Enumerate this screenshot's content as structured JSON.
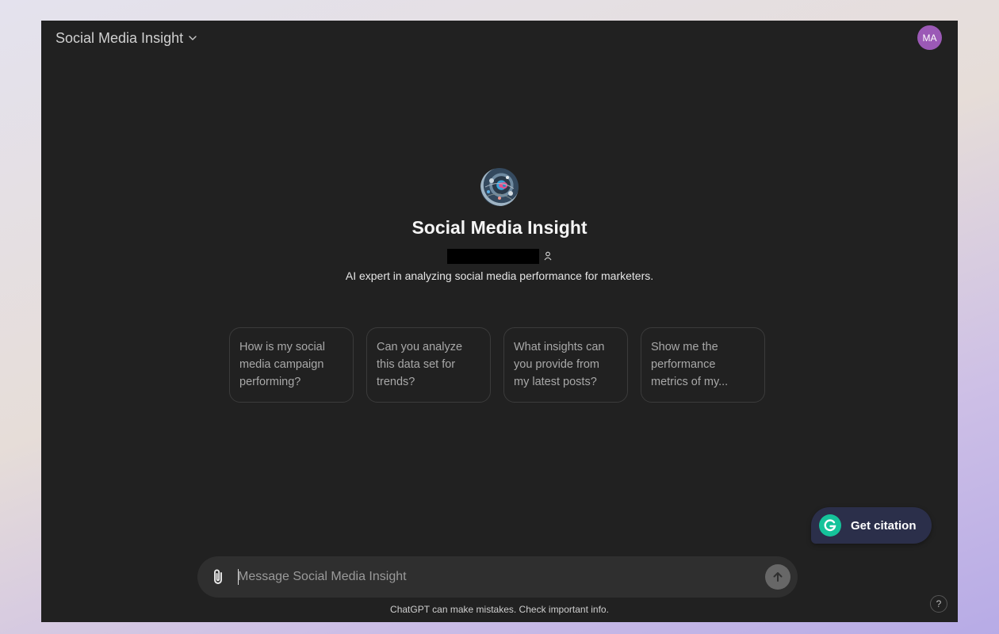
{
  "header": {
    "gpt_name": "Social Media Insight",
    "avatar_initials": "MA"
  },
  "hero": {
    "title": "Social Media Insight",
    "description": "AI expert in analyzing social media performance for marketers."
  },
  "starters": [
    {
      "label": "How is my social media campaign performing?"
    },
    {
      "label": "Can you analyze this data set for trends?"
    },
    {
      "label": "What insights can you provide from my latest posts?"
    },
    {
      "label": "Show me the performance metrics of my..."
    }
  ],
  "composer": {
    "placeholder": "Message Social Media Insight"
  },
  "footer": {
    "disclaimer": "ChatGPT can make mistakes. Check important info.",
    "help_label": "?"
  },
  "citation_widget": {
    "label": "Get citation"
  },
  "colors": {
    "app_background": "#212121",
    "composer_background": "#2f2f2f",
    "avatar": "#9b59b6",
    "citation_background": "#2b2f4a",
    "grammarly_green": "#15c39a"
  },
  "icons": {
    "switcher": "chevron-down-icon",
    "author": "person-icon",
    "attach": "paperclip-icon",
    "send": "arrow-up-icon",
    "citation": "grammarly-icon"
  }
}
